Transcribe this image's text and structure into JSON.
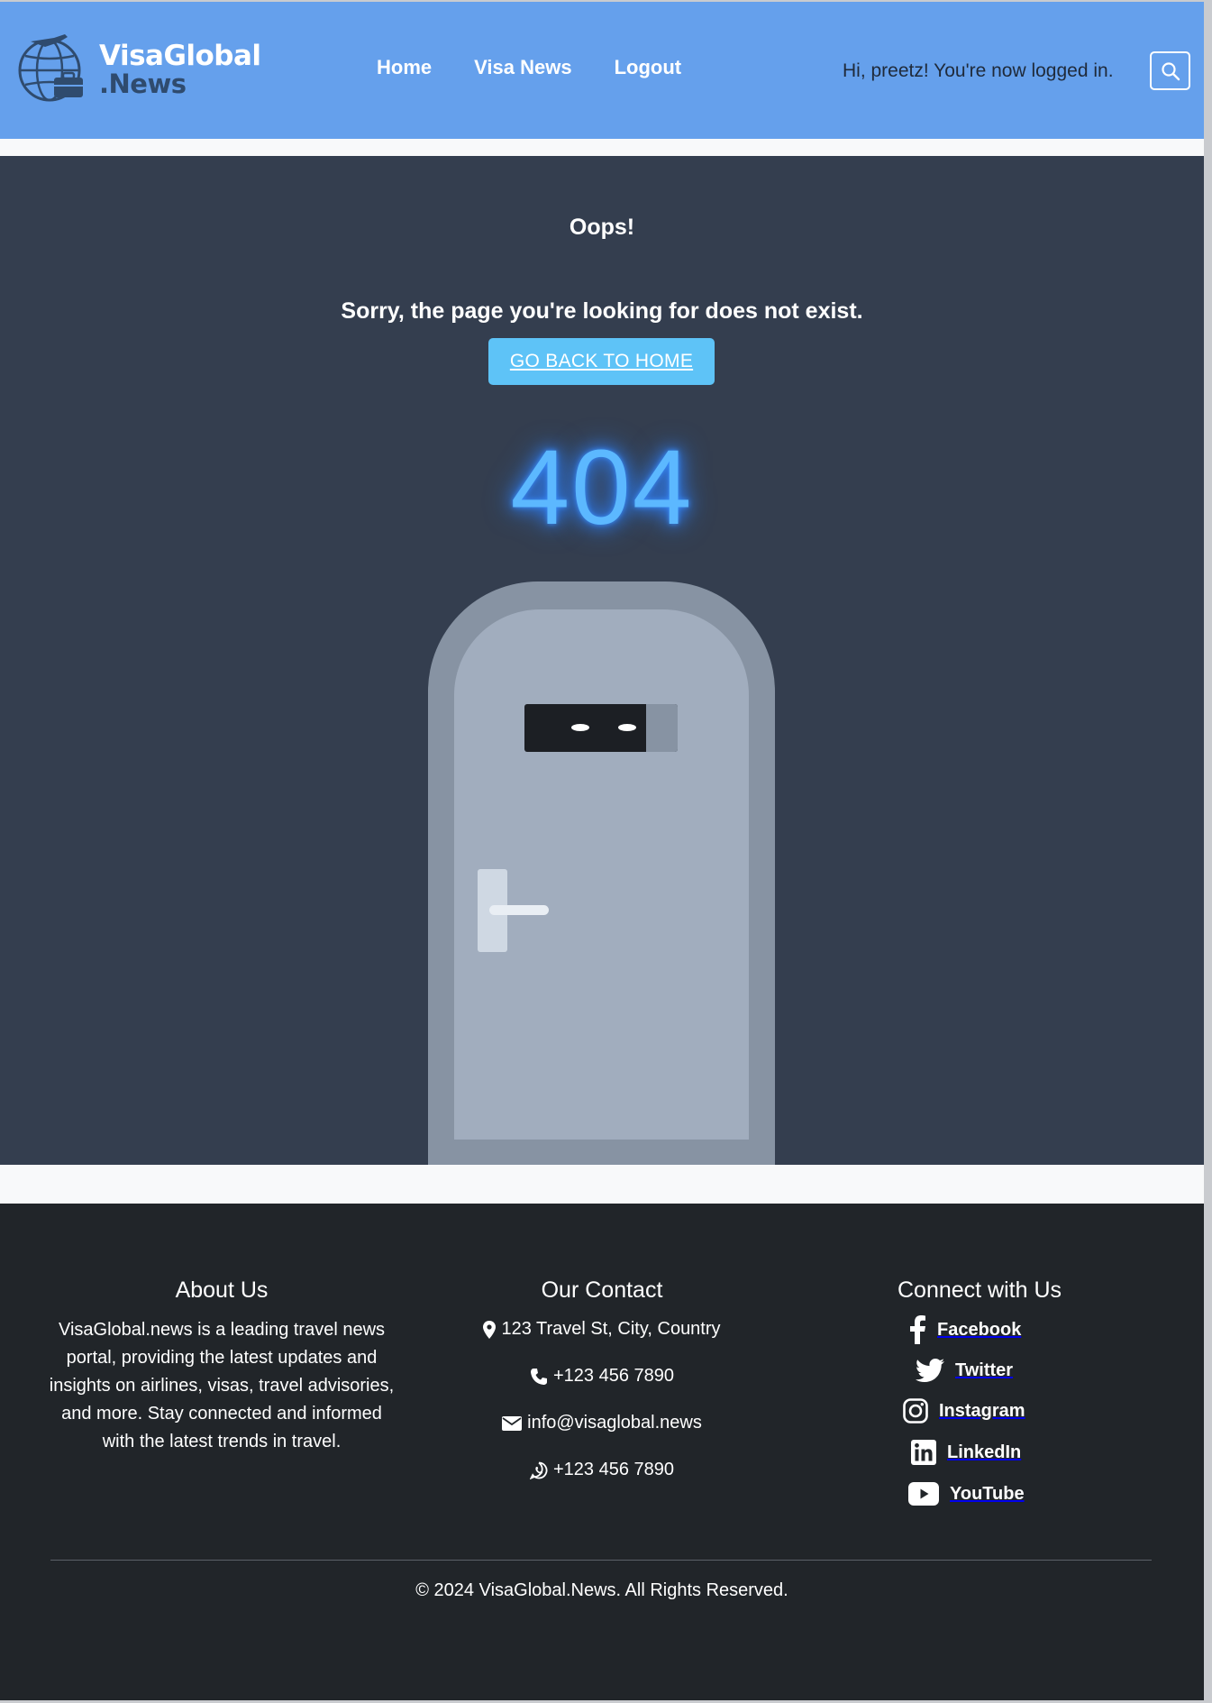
{
  "header": {
    "logo_line1": "VisaGlobal",
    "logo_line2": ".News",
    "nav": [
      "Home",
      "Visa News",
      "Logout"
    ],
    "greeting": "Hi, preetz! You're now logged in.",
    "search_icon": "search-icon"
  },
  "error": {
    "title": "Oops!",
    "message": "Sorry, the page you're looking for does not exist.",
    "button": "GO BACK TO HOME",
    "code": "404"
  },
  "footer": {
    "about": {
      "title": "About Us",
      "text": "VisaGlobal.news is a leading travel news portal, providing the latest updates and insights on airlines, visas, travel advisories, and more. Stay connected and informed with the latest trends in travel."
    },
    "contact": {
      "title": "Our Contact",
      "address": "123 Travel St, City, Country",
      "phone": "+123 456 7890",
      "email": "info@visaglobal.news",
      "whatsapp": "+123 456 7890"
    },
    "social": {
      "title": "Connect with Us",
      "links": [
        "Facebook",
        "Twitter",
        "Instagram",
        "LinkedIn",
        "YouTube"
      ]
    },
    "copyright": "© 2024 VisaGlobal.News. All Rights Reserved."
  },
  "colors": {
    "header_bg": "#65a0ec",
    "main_bg": "#343e4f",
    "footer_bg": "#212529",
    "button_bg": "#5ec3f7",
    "glow": "#5cb8ff"
  }
}
